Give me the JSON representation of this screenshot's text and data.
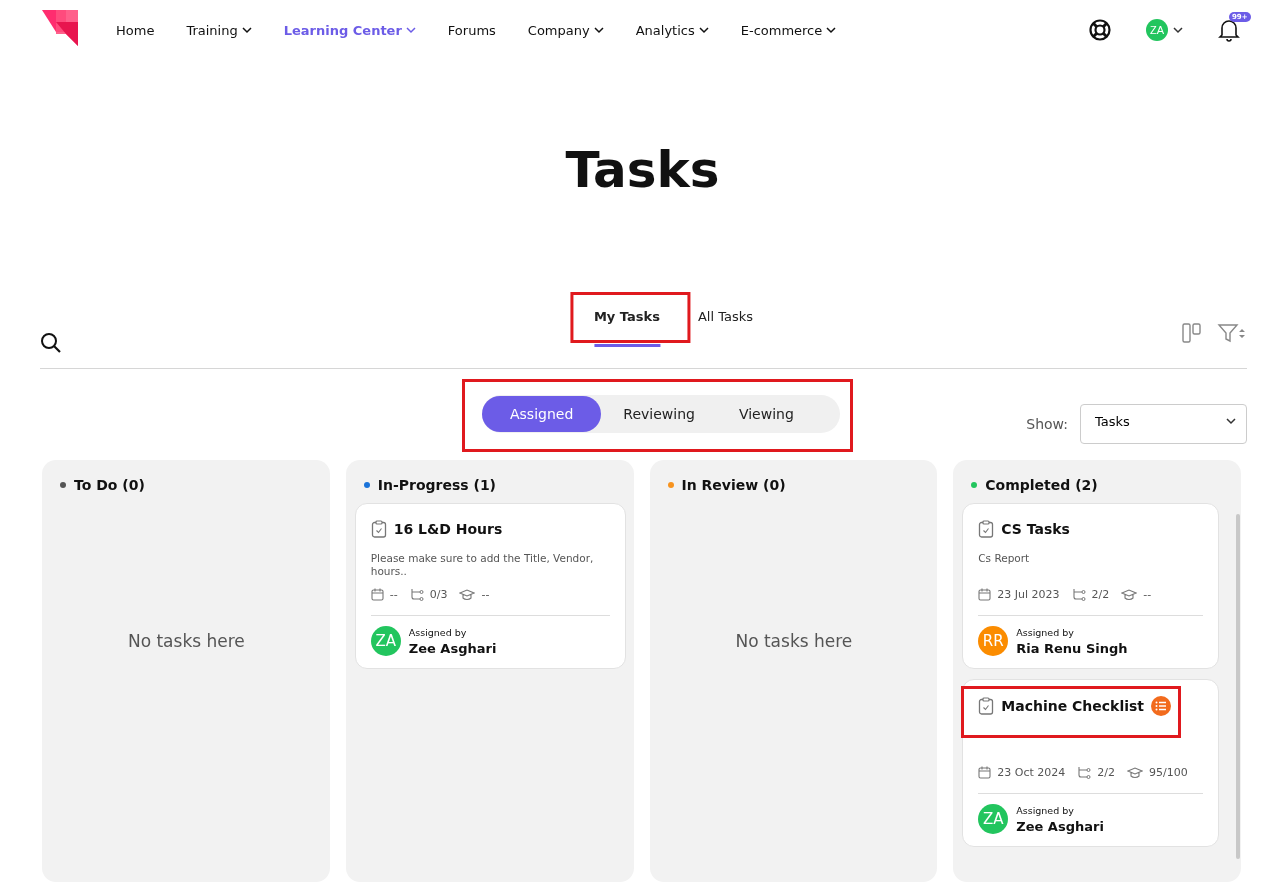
{
  "nav": {
    "items": [
      {
        "label": "Home",
        "has_menu": false,
        "selected": false
      },
      {
        "label": "Training",
        "has_menu": true,
        "selected": false
      },
      {
        "label": "Learning Center",
        "has_menu": true,
        "selected": true
      },
      {
        "label": "Forums",
        "has_menu": false,
        "selected": false
      },
      {
        "label": "Company",
        "has_menu": true,
        "selected": false
      },
      {
        "label": "Analytics",
        "has_menu": true,
        "selected": false
      },
      {
        "label": "E-commerce",
        "has_menu": true,
        "selected": false
      }
    ],
    "user_initials": "ZA",
    "notification_badge": "99+"
  },
  "page_title": "Tasks",
  "tabs": [
    {
      "label": "My Tasks",
      "selected": true,
      "highlighted": true
    },
    {
      "label": "All Tasks",
      "selected": false,
      "highlighted": false
    }
  ],
  "segments": {
    "highlighted": true,
    "items": [
      {
        "label": "Assigned",
        "selected": true
      },
      {
        "label": "Reviewing",
        "selected": false
      },
      {
        "label": "Viewing",
        "selected": false
      }
    ]
  },
  "show": {
    "label": "Show:",
    "value": "Tasks"
  },
  "columns": [
    {
      "title": "To Do (0)",
      "color": "#555555",
      "scrollable": false,
      "empty_text": "No tasks here"
    },
    {
      "title": "In-Progress (1)",
      "color": "#1a73d9",
      "scrollable": false,
      "cards": [
        {
          "title": "16 L&D Hours",
          "checklist": false,
          "highlighted": false,
          "description": "Please make sure to add the Title, Vendor, hours..",
          "date": "--",
          "subtasks": "0/3",
          "score": "--",
          "assigned_label": "Assigned by",
          "initials": "ZA",
          "color": "#22c55e",
          "assigner": "Zee Asghari"
        }
      ]
    },
    {
      "title": "In Review (0)",
      "color": "#f7931e",
      "scrollable": false,
      "empty_text": "No tasks here"
    },
    {
      "title": "Completed (2)",
      "color": "#22c55e",
      "scrollable": true,
      "cards": [
        {
          "title": "CS Tasks",
          "checklist": false,
          "highlighted": false,
          "description": "Cs Report",
          "date": "23 Jul 2023",
          "subtasks": "2/2",
          "score": "--",
          "assigned_label": "Assigned by",
          "initials": "RR",
          "color": "#fb8c00",
          "assigner": "Ria Renu Singh"
        },
        {
          "title": "Machine Checklist",
          "checklist": true,
          "highlighted": true,
          "date": "23 Oct 2024",
          "subtasks": "2/2",
          "score": "95/100",
          "assigned_label": "Assigned by",
          "initials": "ZA",
          "color": "#22c55e",
          "assigner": "Zee Asghari"
        }
      ]
    }
  ]
}
